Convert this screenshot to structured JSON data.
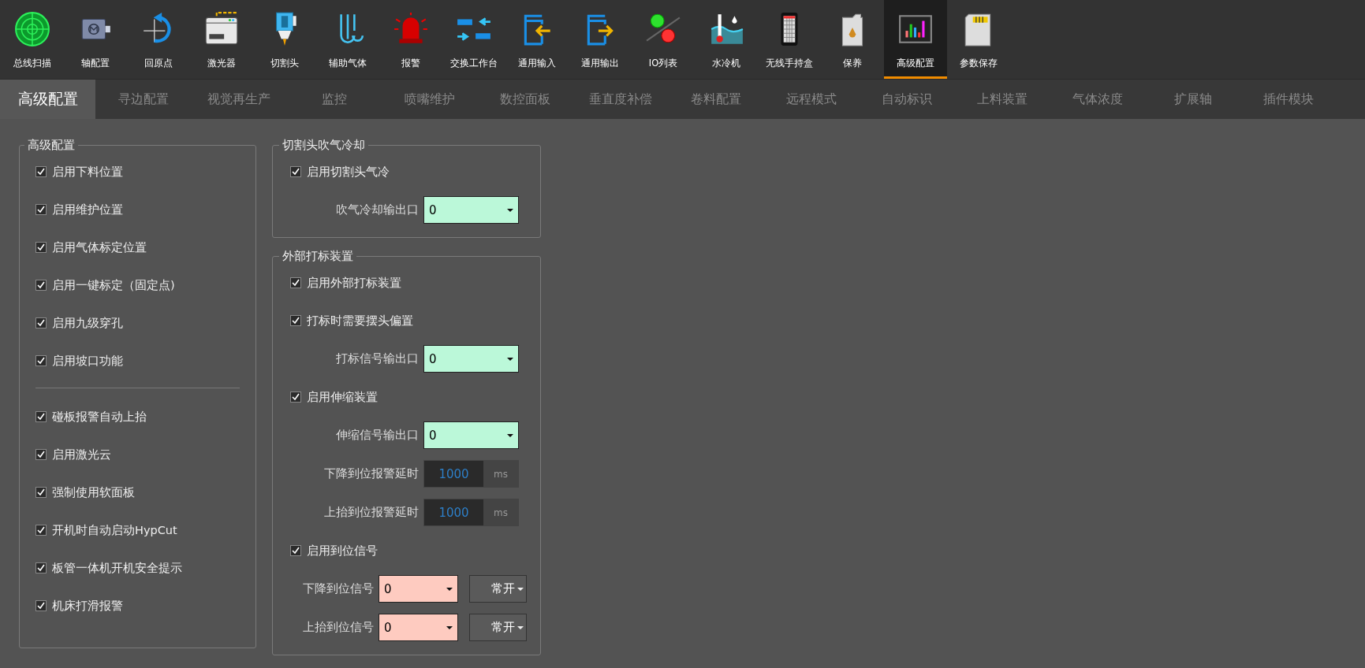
{
  "toolbar": [
    {
      "kind": "radar",
      "label": "总线扫描",
      "selected": false
    },
    {
      "kind": "motor",
      "label": "轴配置",
      "selected": false
    },
    {
      "kind": "origin",
      "label": "回原点",
      "selected": false
    },
    {
      "kind": "laser",
      "label": "激光器",
      "selected": false
    },
    {
      "kind": "head",
      "label": "切割头",
      "selected": false
    },
    {
      "kind": "gas",
      "label": "辅助气体",
      "selected": false
    },
    {
      "kind": "alarm",
      "label": "报警",
      "selected": false
    },
    {
      "kind": "exchange",
      "label": "交换工作台",
      "selected": false
    },
    {
      "kind": "input",
      "label": "通用输入",
      "selected": false
    },
    {
      "kind": "output",
      "label": "通用输出",
      "selected": false
    },
    {
      "kind": "io",
      "label": "IO列表",
      "selected": false
    },
    {
      "kind": "chiller",
      "label": "水冷机",
      "selected": false
    },
    {
      "kind": "remote",
      "label": "无线手持盒",
      "selected": false
    },
    {
      "kind": "oil",
      "label": "保养",
      "selected": false
    },
    {
      "kind": "bars",
      "label": "高级配置",
      "selected": true
    },
    {
      "kind": "save",
      "label": "参数保存",
      "selected": false
    }
  ],
  "tabs": [
    {
      "label": "高级配置",
      "selected": true
    },
    {
      "label": "寻边配置",
      "selected": false
    },
    {
      "label": "视觉再生产",
      "selected": false
    },
    {
      "label": "监控",
      "selected": false
    },
    {
      "label": "喷嘴维护",
      "selected": false
    },
    {
      "label": "数控面板",
      "selected": false
    },
    {
      "label": "垂直度补偿",
      "selected": false
    },
    {
      "label": "卷料配置",
      "selected": false
    },
    {
      "label": "远程模式",
      "selected": false
    },
    {
      "label": "自动标识",
      "selected": false
    },
    {
      "label": "上料装置",
      "selected": false
    },
    {
      "label": "气体浓度",
      "selected": false
    },
    {
      "label": "扩展轴",
      "selected": false
    },
    {
      "label": "插件模块",
      "selected": false
    }
  ],
  "advanced": {
    "title": "高级配置",
    "groups": [
      {
        "items": [
          {
            "label": "启用下料位置",
            "checked": true
          },
          {
            "label": "启用维护位置",
            "checked": true
          },
          {
            "label": "启用气体标定位置",
            "checked": true
          },
          {
            "label": "启用一键标定（固定点)",
            "checked": true
          },
          {
            "label": "启用九级穿孔",
            "checked": true
          },
          {
            "label": "启用坡口功能",
            "checked": true
          }
        ]
      },
      {
        "items": [
          {
            "label": "碰板报警自动上抬",
            "checked": true
          },
          {
            "label": "启用激光云",
            "checked": true
          },
          {
            "label": "强制使用软面板",
            "checked": true
          },
          {
            "label": "开机时自动启动HypCut",
            "checked": true
          },
          {
            "label": "板管一体机开机安全提示",
            "checked": true
          },
          {
            "label": "机床打滑报警",
            "checked": true
          }
        ]
      }
    ]
  },
  "sections": [
    {
      "title": "切割头吹气冷却",
      "rows": [
        {
          "kind": "checkbox",
          "label": "启用切割头气冷",
          "checked": true
        },
        {
          "kind": "select",
          "label": "吹气冷却输出口",
          "value": "0",
          "color": "#bbf8d9"
        }
      ]
    },
    {
      "title": "外部打标装置",
      "rows": [
        {
          "kind": "checkbox",
          "label": "启用外部打标装置",
          "checked": true
        },
        {
          "kind": "checkbox",
          "label": "打标时需要摆头偏置",
          "checked": true
        },
        {
          "kind": "select",
          "label": "打标信号输出口",
          "value": "0",
          "color": "#bbf8d9"
        },
        {
          "kind": "checkbox",
          "label": "启用伸缩装置",
          "checked": true
        },
        {
          "kind": "select",
          "label": "伸缩信号输出口",
          "value": "0",
          "color": "#bbf8d9"
        },
        {
          "kind": "number",
          "label": "下降到位报警延时",
          "value": "1000",
          "unit": "ms"
        },
        {
          "kind": "number",
          "label": "上抬到位报警延时",
          "value": "1000",
          "unit": "ms"
        },
        {
          "kind": "checkbox",
          "label": "启用到位信号",
          "checked": true
        },
        {
          "kind": "signal",
          "label": "下降到位信号",
          "value": "0",
          "color": "#fecbc0",
          "mode": "常开"
        },
        {
          "kind": "signal",
          "label": "上抬到位信号",
          "value": "0",
          "color": "#fecbc0",
          "mode": "常开"
        }
      ]
    }
  ]
}
